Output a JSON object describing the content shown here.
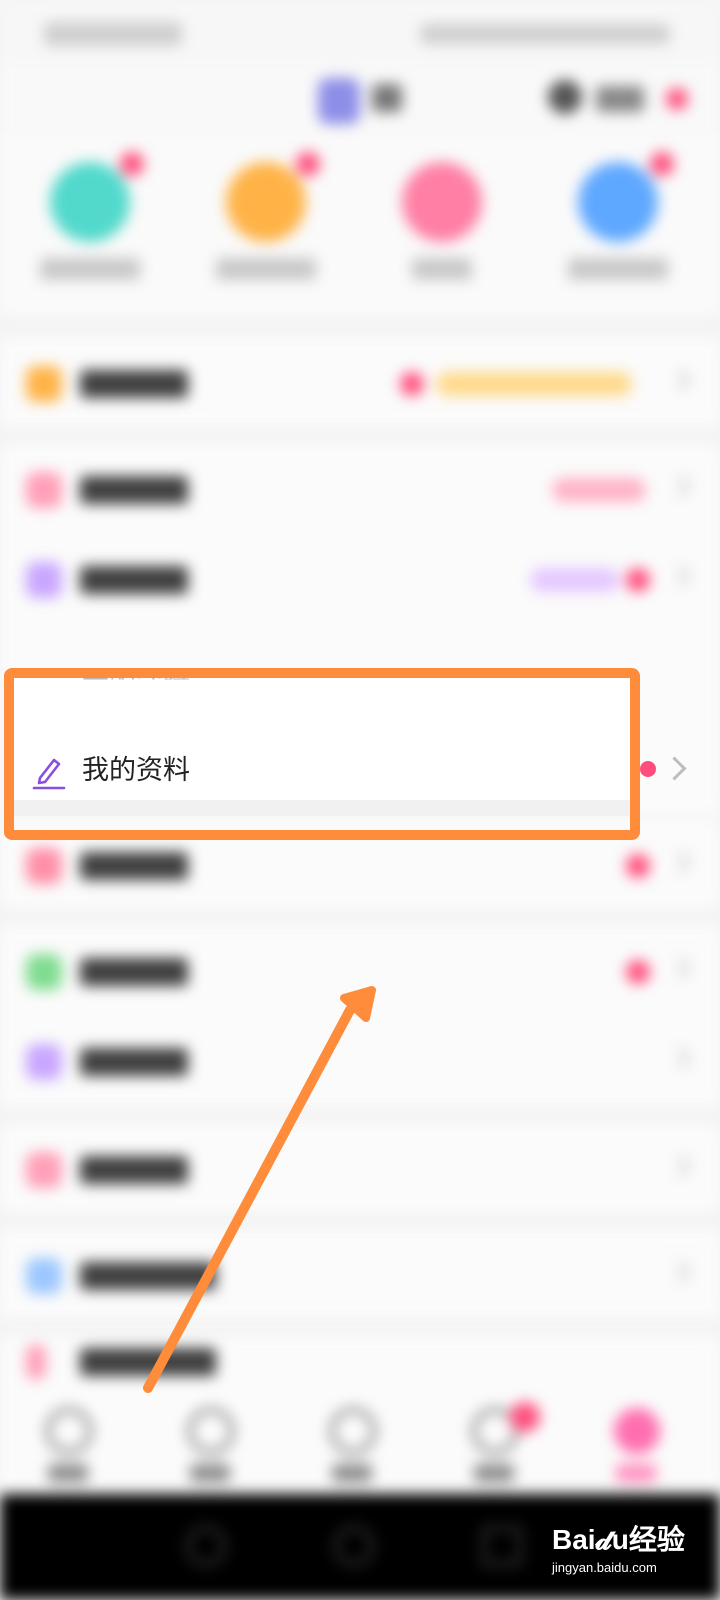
{
  "profile_menu": {
    "focused_item_label": "我的资料",
    "focused_item_icon": "pencil-icon",
    "partial_item_above_label": "我的守缘"
  },
  "annotation": {
    "box_color": "#ff8c3a",
    "arrow_color": "#ff8c3a"
  },
  "watermark": {
    "logo_text": "Bai𝓭u经验",
    "url": "jingyan.baidu.com"
  },
  "colors": {
    "accent_purple": "#8b4fe0",
    "badge_red": "#ff4d7d"
  }
}
